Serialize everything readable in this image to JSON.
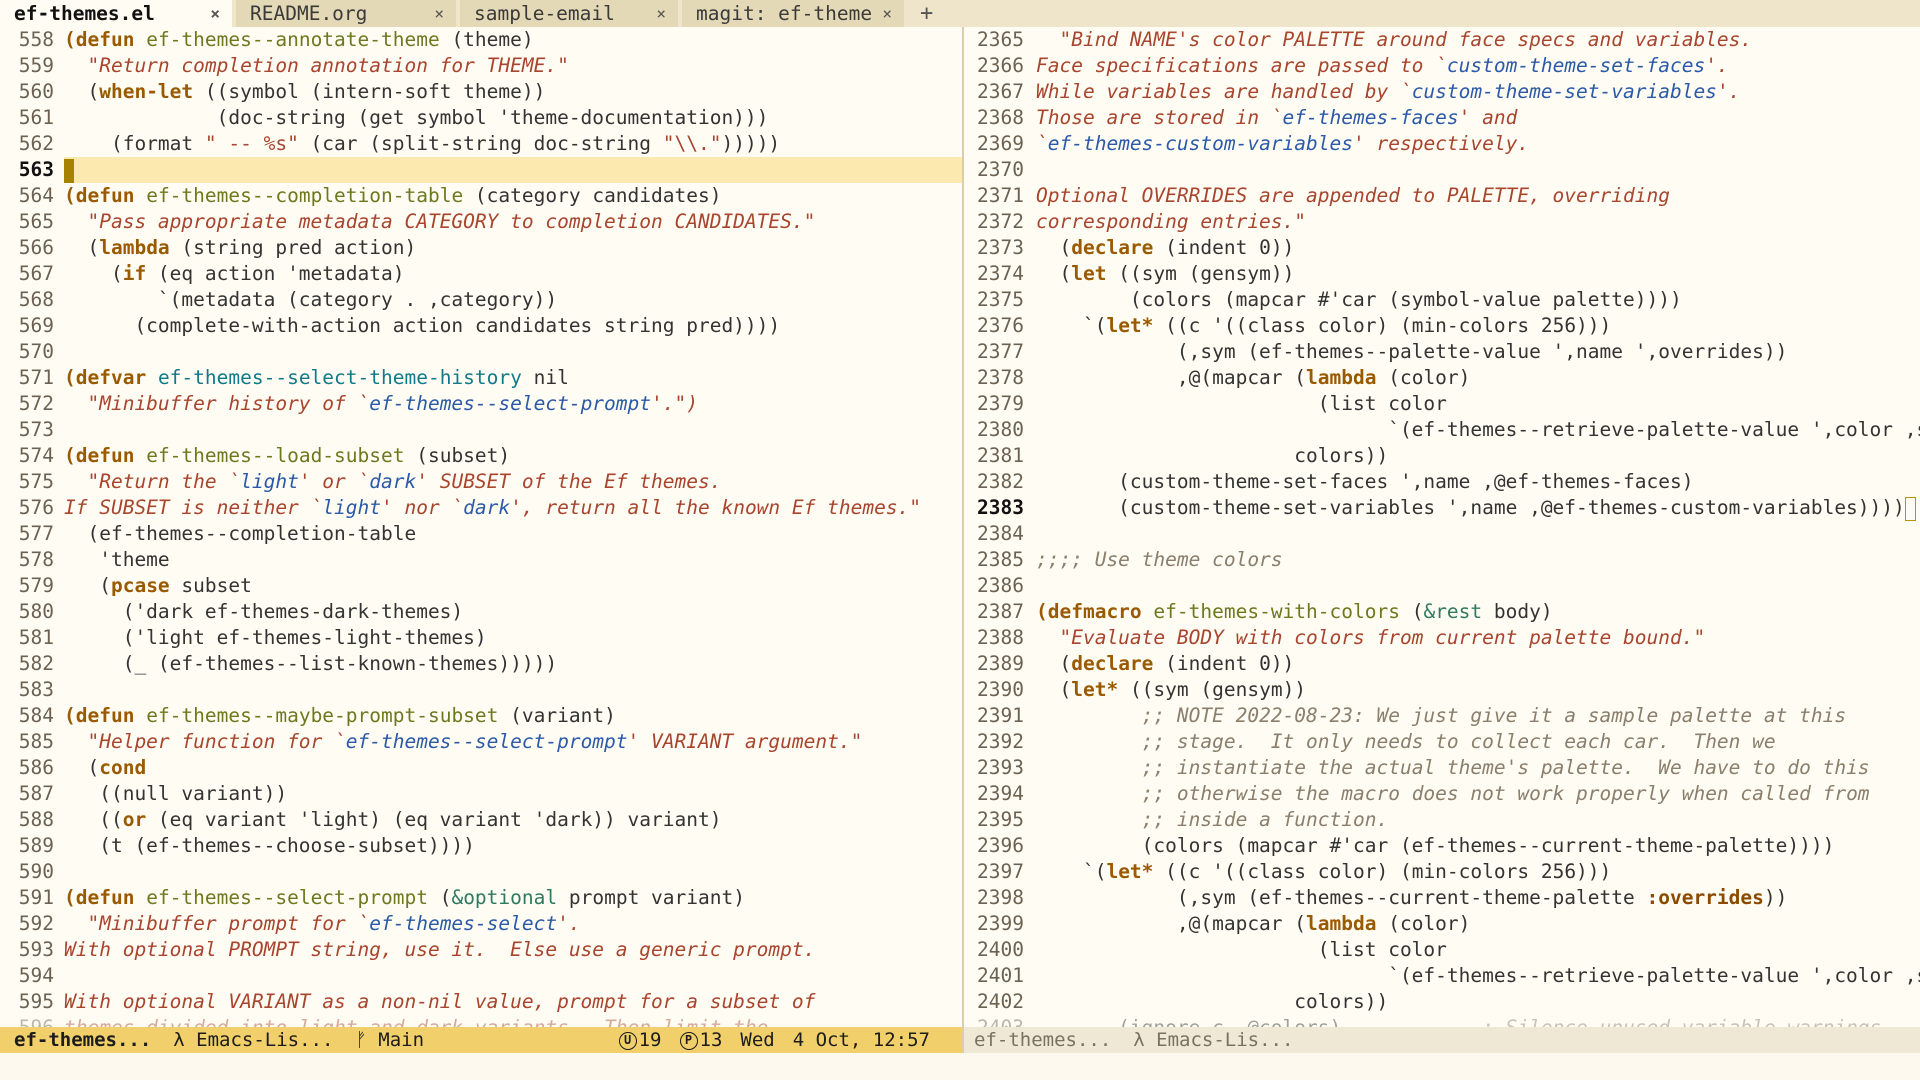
{
  "tabs": [
    {
      "label": "ef-themes.el",
      "active": true,
      "close": "×"
    },
    {
      "label": "README.org",
      "active": false,
      "close": "×"
    },
    {
      "label": "sample-email",
      "active": false,
      "close": "×"
    },
    {
      "label": "magit: ef-themes",
      "active": false,
      "close": "×"
    }
  ],
  "new_tab_label": "+",
  "left_pane": {
    "lines": [
      {
        "n": "558",
        "c": [
          [
            "kw",
            "(defun"
          ],
          [
            "p",
            " "
          ],
          [
            "fn",
            "ef-themes--annotate-theme"
          ],
          [
            "p",
            " (theme)"
          ]
        ]
      },
      {
        "n": "559",
        "c": [
          [
            "p",
            "  "
          ],
          [
            "doc",
            "\"Return completion annotation for THEME.\""
          ]
        ]
      },
      {
        "n": "560",
        "c": [
          [
            "p",
            "  ("
          ],
          [
            "kw",
            "when-let"
          ],
          [
            "p",
            " ((symbol (intern-soft theme))"
          ]
        ]
      },
      {
        "n": "561",
        "c": [
          [
            "p",
            "             (doc-string (get symbol 'theme-documentation)))"
          ]
        ]
      },
      {
        "n": "562",
        "c": [
          [
            "p",
            "    (format "
          ],
          [
            "str",
            "\" -- %s\""
          ],
          [
            "p",
            " (car (split-string doc-string "
          ],
          [
            "str",
            "\"\\\\.\""
          ],
          [
            "p",
            "))))) "
          ]
        ]
      },
      {
        "n": "563",
        "cur": true,
        "c": []
      },
      {
        "n": "564",
        "c": [
          [
            "kw",
            "(defun"
          ],
          [
            "p",
            " "
          ],
          [
            "fn",
            "ef-themes--completion-table"
          ],
          [
            "p",
            " (category candidates)"
          ]
        ]
      },
      {
        "n": "565",
        "c": [
          [
            "p",
            "  "
          ],
          [
            "doc",
            "\"Pass appropriate metadata CATEGORY to completion CANDIDATES.\""
          ]
        ]
      },
      {
        "n": "566",
        "c": [
          [
            "p",
            "  ("
          ],
          [
            "kw",
            "lambda"
          ],
          [
            "p",
            " (string pred action)"
          ]
        ]
      },
      {
        "n": "567",
        "c": [
          [
            "p",
            "    ("
          ],
          [
            "kw",
            "if"
          ],
          [
            "p",
            " (eq action 'metadata)"
          ]
        ]
      },
      {
        "n": "568",
        "c": [
          [
            "p",
            "        `(metadata (category . ,category))"
          ]
        ]
      },
      {
        "n": "569",
        "c": [
          [
            "p",
            "      (complete-with-action action candidates string pred))))"
          ]
        ]
      },
      {
        "n": "570",
        "c": []
      },
      {
        "n": "571",
        "c": [
          [
            "kw",
            "(defvar"
          ],
          [
            "p",
            " "
          ],
          [
            "var",
            "ef-themes--select-theme-history"
          ],
          [
            "p",
            " nil"
          ]
        ]
      },
      {
        "n": "572",
        "c": [
          [
            "p",
            "  "
          ],
          [
            "doc",
            "\"Minibuffer history of `"
          ],
          [
            "ref",
            "ef-themes--select-prompt"
          ],
          [
            "doc",
            "'.\")"
          ]
        ]
      },
      {
        "n": "573",
        "c": []
      },
      {
        "n": "574",
        "c": [
          [
            "kw",
            "(defun"
          ],
          [
            "p",
            " "
          ],
          [
            "fn",
            "ef-themes--load-subset"
          ],
          [
            "p",
            " (subset)"
          ]
        ]
      },
      {
        "n": "575",
        "c": [
          [
            "p",
            "  "
          ],
          [
            "doc",
            "\"Return the `"
          ],
          [
            "ref",
            "light"
          ],
          [
            "doc",
            "' or `"
          ],
          [
            "ref",
            "dark"
          ],
          [
            "doc",
            "' SUBSET of the Ef themes."
          ]
        ]
      },
      {
        "n": "576",
        "c": [
          [
            "doc",
            "If SUBSET is neither `"
          ],
          [
            "ref",
            "light"
          ],
          [
            "doc",
            "' nor `"
          ],
          [
            "ref",
            "dark"
          ],
          [
            "doc",
            "', return all the known Ef themes.\""
          ]
        ]
      },
      {
        "n": "577",
        "c": [
          [
            "p",
            "  (ef-themes--completion-table"
          ]
        ]
      },
      {
        "n": "578",
        "c": [
          [
            "p",
            "   'theme"
          ]
        ]
      },
      {
        "n": "579",
        "c": [
          [
            "p",
            "   ("
          ],
          [
            "kw",
            "pcase"
          ],
          [
            "p",
            " subset"
          ]
        ]
      },
      {
        "n": "580",
        "c": [
          [
            "p",
            "     ('dark ef-themes-dark-themes)"
          ]
        ]
      },
      {
        "n": "581",
        "c": [
          [
            "p",
            "     ('light ef-themes-light-themes)"
          ]
        ]
      },
      {
        "n": "582",
        "c": [
          [
            "p",
            "     (_ (ef-themes--list-known-themes)))))"
          ]
        ]
      },
      {
        "n": "583",
        "c": []
      },
      {
        "n": "584",
        "c": [
          [
            "kw",
            "(defun"
          ],
          [
            "p",
            " "
          ],
          [
            "fn",
            "ef-themes--maybe-prompt-subset"
          ],
          [
            "p",
            " (variant)"
          ]
        ]
      },
      {
        "n": "585",
        "c": [
          [
            "p",
            "  "
          ],
          [
            "doc",
            "\"Helper function for `"
          ],
          [
            "ref",
            "ef-themes--select-prompt"
          ],
          [
            "doc",
            "' VARIANT argument.\""
          ]
        ]
      },
      {
        "n": "586",
        "c": [
          [
            "p",
            "  ("
          ],
          [
            "kw",
            "cond"
          ]
        ]
      },
      {
        "n": "587",
        "c": [
          [
            "p",
            "   ((null variant))"
          ]
        ]
      },
      {
        "n": "588",
        "c": [
          [
            "p",
            "   (("
          ],
          [
            "kw",
            "or"
          ],
          [
            "p",
            " (eq variant 'light) (eq variant 'dark)) variant)"
          ]
        ]
      },
      {
        "n": "589",
        "c": [
          [
            "p",
            "   (t (ef-themes--choose-subset))))"
          ]
        ]
      },
      {
        "n": "590",
        "c": []
      },
      {
        "n": "591",
        "c": [
          [
            "kw",
            "(defun"
          ],
          [
            "p",
            " "
          ],
          [
            "fn",
            "ef-themes--select-prompt"
          ],
          [
            "p",
            " ("
          ],
          [
            "bi",
            "&optional"
          ],
          [
            "p",
            " prompt variant)"
          ]
        ]
      },
      {
        "n": "592",
        "c": [
          [
            "p",
            "  "
          ],
          [
            "doc",
            "\"Minibuffer prompt for `"
          ],
          [
            "ref",
            "ef-themes-select"
          ],
          [
            "doc",
            "'."
          ]
        ]
      },
      {
        "n": "593",
        "c": [
          [
            "doc",
            "With optional PROMPT string, use it.  Else use a generic prompt."
          ]
        ]
      },
      {
        "n": "594",
        "c": []
      },
      {
        "n": "595",
        "c": [
          [
            "doc",
            "With optional VARIANT as a non-nil value, prompt for a subset of"
          ]
        ]
      },
      {
        "n": "596",
        "cut": true,
        "c": [
          [
            "doc",
            "themes divided into light and dark variants.  Then limit the"
          ]
        ]
      }
    ]
  },
  "right_pane": {
    "lines": [
      {
        "n": "2365",
        "c": [
          [
            "p",
            "  "
          ],
          [
            "doc",
            "\"Bind NAME's color PALETTE around face specs and variables."
          ]
        ]
      },
      {
        "n": "2366",
        "c": [
          [
            "doc",
            "Face specifications are passed to `"
          ],
          [
            "ref",
            "custom-theme-set-faces"
          ],
          [
            "doc",
            "'."
          ]
        ]
      },
      {
        "n": "2367",
        "c": [
          [
            "doc",
            "While variables are handled by `"
          ],
          [
            "ref",
            "custom-theme-set-variables"
          ],
          [
            "doc",
            "'."
          ]
        ]
      },
      {
        "n": "2368",
        "c": [
          [
            "doc",
            "Those are stored in `"
          ],
          [
            "ref",
            "ef-themes-faces"
          ],
          [
            "doc",
            "' and"
          ]
        ]
      },
      {
        "n": "2369",
        "c": [
          [
            "doc",
            "`"
          ],
          [
            "ref",
            "ef-themes-custom-variables"
          ],
          [
            "doc",
            "' respectively."
          ]
        ]
      },
      {
        "n": "2370",
        "c": []
      },
      {
        "n": "2371",
        "c": [
          [
            "doc",
            "Optional OVERRIDES are appended to PALETTE, overriding"
          ]
        ]
      },
      {
        "n": "2372",
        "c": [
          [
            "doc",
            "corresponding entries.\""
          ]
        ]
      },
      {
        "n": "2373",
        "c": [
          [
            "p",
            "  ("
          ],
          [
            "kw",
            "declare"
          ],
          [
            "p",
            " (indent 0))"
          ]
        ]
      },
      {
        "n": "2374",
        "c": [
          [
            "p",
            "  ("
          ],
          [
            "kw",
            "let"
          ],
          [
            "p",
            " ((sym (gensym))"
          ]
        ]
      },
      {
        "n": "2375",
        "c": [
          [
            "p",
            "        (colors (mapcar #'car (symbol-value palette))))"
          ]
        ]
      },
      {
        "n": "2376",
        "c": [
          [
            "p",
            "    `("
          ],
          [
            "kw",
            "let*"
          ],
          [
            "p",
            " ((c '((class color) (min-colors 256)))"
          ]
        ]
      },
      {
        "n": "2377",
        "c": [
          [
            "p",
            "            (,sym (ef-themes--palette-value ',name ',overrides))"
          ]
        ]
      },
      {
        "n": "2378",
        "c": [
          [
            "p",
            "            ,@(mapcar ("
          ],
          [
            "kw",
            "lambda"
          ],
          [
            "p",
            " (color)"
          ]
        ]
      },
      {
        "n": "2379",
        "c": [
          [
            "p",
            "                        (list color"
          ]
        ]
      },
      {
        "n": "2380",
        "c": [
          [
            "p",
            "                              `(ef-themes--retrieve-palette-value ',color ,sym))"
          ]
        ]
      },
      {
        "n": "2381",
        "c": [
          [
            "p",
            "                      colors))"
          ]
        ]
      },
      {
        "n": "2382",
        "c": [
          [
            "p",
            "       (custom-theme-set-faces ',name ,@ef-themes-faces)"
          ]
        ]
      },
      {
        "n": "2383",
        "cur": true,
        "c": [
          [
            "p",
            "       (custom-theme-set-variables ',name ,@ef-themes-custom-variables))))"
          ]
        ]
      },
      {
        "n": "2384",
        "c": []
      },
      {
        "n": "2385",
        "c": [
          [
            "cmt",
            ";;;; Use theme colors"
          ]
        ]
      },
      {
        "n": "2386",
        "c": []
      },
      {
        "n": "2387",
        "c": [
          [
            "kw",
            "(defmacro"
          ],
          [
            "p",
            " "
          ],
          [
            "fn",
            "ef-themes-with-colors"
          ],
          [
            "p",
            " ("
          ],
          [
            "bi",
            "&rest"
          ],
          [
            "p",
            " body)"
          ]
        ]
      },
      {
        "n": "2388",
        "c": [
          [
            "p",
            "  "
          ],
          [
            "doc",
            "\"Evaluate BODY with colors from current palette bound.\""
          ]
        ]
      },
      {
        "n": "2389",
        "c": [
          [
            "p",
            "  ("
          ],
          [
            "kw",
            "declare"
          ],
          [
            "p",
            " (indent 0))"
          ]
        ]
      },
      {
        "n": "2390",
        "c": [
          [
            "p",
            "  ("
          ],
          [
            "kw",
            "let*"
          ],
          [
            "p",
            " ((sym (gensym))"
          ]
        ]
      },
      {
        "n": "2391",
        "c": [
          [
            "p",
            "         "
          ],
          [
            "cmt",
            ";; NOTE 2022-08-23: We just give it a sample palette at this"
          ]
        ]
      },
      {
        "n": "2392",
        "c": [
          [
            "p",
            "         "
          ],
          [
            "cmt",
            ";; stage.  It only needs to collect each car.  Then we"
          ]
        ]
      },
      {
        "n": "2393",
        "c": [
          [
            "p",
            "         "
          ],
          [
            "cmt",
            ";; instantiate the actual theme's palette.  We have to do this"
          ]
        ]
      },
      {
        "n": "2394",
        "c": [
          [
            "p",
            "         "
          ],
          [
            "cmt",
            ";; otherwise the macro does not work properly when called from"
          ]
        ]
      },
      {
        "n": "2395",
        "c": [
          [
            "p",
            "         "
          ],
          [
            "cmt",
            ";; inside a function."
          ]
        ]
      },
      {
        "n": "2396",
        "c": [
          [
            "p",
            "         (colors (mapcar #'car (ef-themes--current-theme-palette))))"
          ]
        ]
      },
      {
        "n": "2397",
        "c": [
          [
            "p",
            "    `("
          ],
          [
            "kw",
            "let*"
          ],
          [
            "p",
            " ((c '((class color) (min-colors 256)))"
          ]
        ]
      },
      {
        "n": "2398",
        "c": [
          [
            "p",
            "            (,sym (ef-themes--current-theme-palette "
          ],
          [
            "kwd",
            ":overrides"
          ],
          [
            "p",
            "))"
          ]
        ]
      },
      {
        "n": "2399",
        "c": [
          [
            "p",
            "            ,@(mapcar ("
          ],
          [
            "kw",
            "lambda"
          ],
          [
            "p",
            " (color)"
          ]
        ]
      },
      {
        "n": "2400",
        "c": [
          [
            "p",
            "                        (list color"
          ]
        ]
      },
      {
        "n": "2401",
        "c": [
          [
            "p",
            "                              `(ef-themes--retrieve-palette-value ',color ,sym))"
          ]
        ]
      },
      {
        "n": "2402",
        "c": [
          [
            "p",
            "                      colors))"
          ]
        ]
      },
      {
        "n": "2403",
        "cut": true,
        "c": [
          [
            "p",
            "       (ignore c ,@colors)            "
          ],
          [
            "cmt",
            "; Silence unused variable warnings"
          ]
        ]
      }
    ]
  },
  "modeline_left": {
    "buffer": "ef-themes...",
    "mode": "λ Emacs-Lis...",
    "branch": "ᚠ Main",
    "badge_u": "U",
    "count_u": "19",
    "badge_p": "P",
    "count_p": "13",
    "day": "Wed",
    "date": "4 Oct, 12:57"
  },
  "modeline_right": {
    "buffer": "ef-themes...",
    "mode": "λ Emacs-Lis..."
  }
}
